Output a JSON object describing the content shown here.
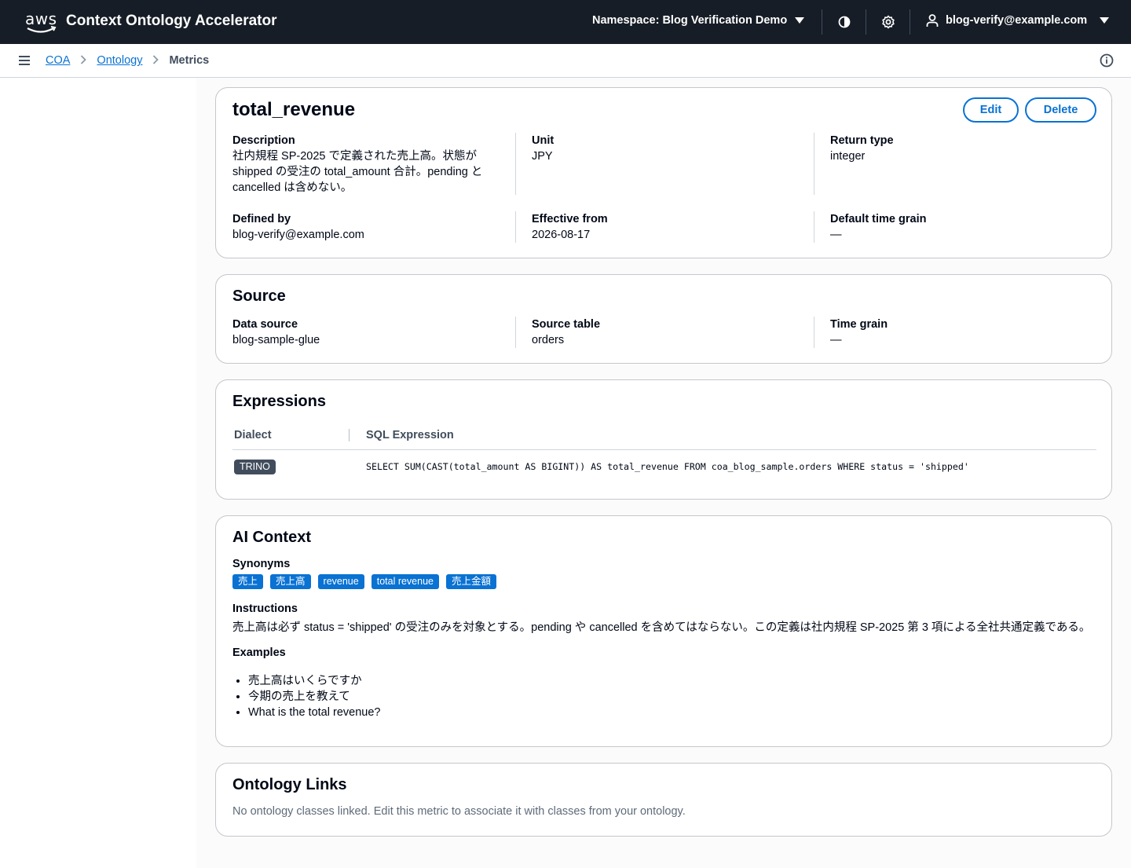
{
  "header": {
    "logo": "aws",
    "title": "Context Ontology Accelerator",
    "namespace": "Namespace: Blog Verification Demo",
    "user": "blog-verify@example.com",
    "icons": [
      "contrast-icon",
      "settings-icon",
      "user-icon"
    ]
  },
  "breadcrumb": {
    "items": [
      "COA",
      "Ontology"
    ],
    "current": "Metrics"
  },
  "metric": {
    "name": "total_revenue",
    "edit_label": "Edit",
    "delete_label": "Delete",
    "description_label": "Description",
    "description_lines": [
      "社内規程 SP-2025 で定義された売上高。状態が",
      "shipped の受注の total_amount 合計。pending と",
      "cancelled は含めない。"
    ],
    "unit_label": "Unit",
    "unit": "JPY",
    "return_type_label": "Return type",
    "return_type": "integer",
    "defined_by_label": "Defined by",
    "defined_by": "blog-verify@example.com",
    "effective_from_label": "Effective from",
    "effective_from": "2026-08-17",
    "default_time_grain_label": "Default time grain",
    "default_time_grain": "—"
  },
  "source": {
    "title": "Source",
    "data_source_label": "Data source",
    "data_source": "blog-sample-glue",
    "source_table_label": "Source table",
    "source_table": "orders",
    "time_grain_label": "Time grain",
    "time_grain": "—"
  },
  "expressions": {
    "title": "Expressions",
    "columns": [
      "Dialect",
      "SQL Expression"
    ],
    "rows": [
      {
        "dialect": "TRINO",
        "sql": "SELECT SUM(CAST(total_amount AS BIGINT)) AS total_revenue FROM coa_blog_sample.orders WHERE status = 'shipped'"
      }
    ]
  },
  "ai_context": {
    "title": "AI Context",
    "synonyms_label": "Synonyms",
    "synonyms": [
      "売上",
      "売上高",
      "revenue",
      "total revenue",
      "売上金額"
    ],
    "instructions_label": "Instructions",
    "instructions": "売上高は必ず status = 'shipped' の受注のみを対象とする。pending や cancelled を含めてはならない。この定義は社内規程 SP-2025 第 3 項による全社共通定義である。",
    "examples_label": "Examples",
    "examples": [
      "売上高はいくらですか",
      "今期の売上を教えて",
      "What is the total revenue?"
    ]
  },
  "ontology_links": {
    "title": "Ontology Links",
    "empty_message": "No ontology classes linked. Edit this metric to associate it with classes from your ontology."
  }
}
